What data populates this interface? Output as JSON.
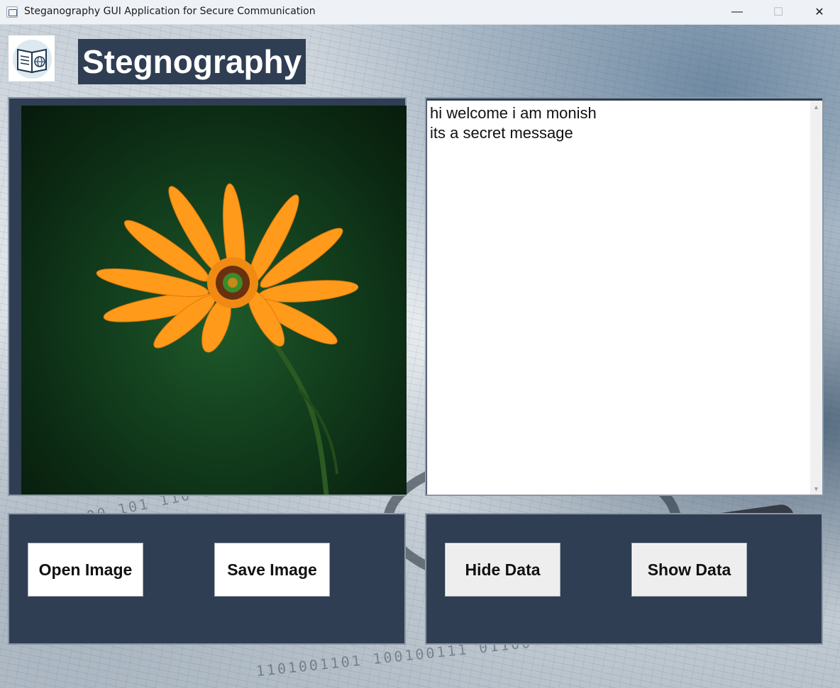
{
  "window": {
    "title": "Steganography GUI Application for Secure Communication",
    "controls": {
      "minimize": "—",
      "maximize": "☐",
      "close": "✕"
    }
  },
  "header": {
    "logo_icon": "book-globe-icon",
    "heading": "Stegnography"
  },
  "image_panel": {
    "image_description_icon": "orange-flower-image"
  },
  "message_panel": {
    "text": "hi welcome i am monish\nits a secret message",
    "scroll_up": "▲",
    "scroll_down": "▼"
  },
  "buttons": {
    "open_image": "Open Image",
    "save_image": "Save Image",
    "hide_data": "Hide Data",
    "show_data": "Show Data"
  },
  "colors": {
    "panel": "#2f3e53",
    "panel_border": "#8b97a4",
    "heading_bg": "#2f3e53",
    "flower_petal": "#ff9a1a",
    "flower_center": "#5a2a10",
    "leaf_background": "#13401e"
  }
}
